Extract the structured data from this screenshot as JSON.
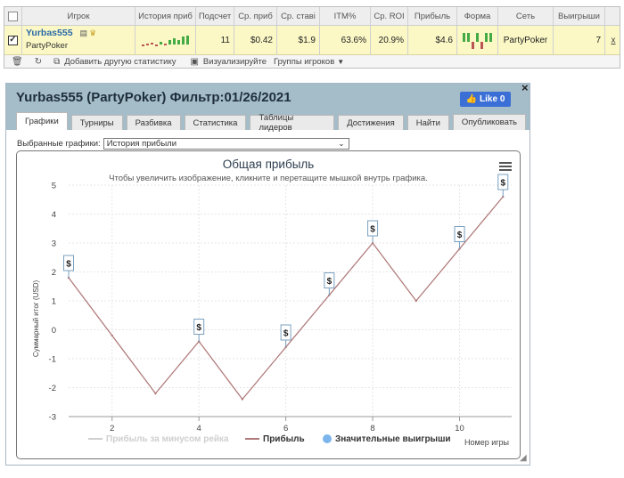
{
  "stats_table": {
    "headers": {
      "player": "Игрок",
      "profit_history": "История приб",
      "count": "Подсчет",
      "avg_profit": "Ср. приб",
      "avg_stake": "Ср. ставі",
      "itm": "ITM%",
      "avg_roi": "Ср. ROI",
      "profit": "Прибыль",
      "form": "Форма",
      "network": "Сеть",
      "wins": "Выигрыши"
    },
    "row": {
      "player_name": "Yurbas555",
      "player_network": "PartyPoker",
      "count": "11",
      "avg_profit": "$0.42",
      "avg_stake": "$1.9",
      "itm": "63.6%",
      "avg_roi": "20.9%",
      "profit": "$4.6",
      "network": "PartyPoker",
      "wins": "7",
      "remove": "x"
    },
    "toolbar": {
      "add_stats": "Добавить другую статистику",
      "visualize": "Визуализируйте",
      "player_groups": "Группы игроков"
    }
  },
  "dialog": {
    "title": "Yurbas555 (PartyPoker) Фильтр:01/26/2021",
    "like_label": "Like 0",
    "close": "×",
    "tabs": [
      "Графики",
      "Турниры",
      "Разбивка",
      "Статистика",
      "Таблицы лидеров",
      "Достижения",
      "Найти"
    ],
    "publish": "Опубликовать",
    "selected_charts_label": "Выбранные графики:",
    "selected_chart_value": "История прибыли"
  },
  "colors": {
    "accent": "#2a6aa8",
    "profit_line": "#b07a7a",
    "rake_line": "#cfcfcf",
    "big_wins_marker": "#7cb5ec",
    "like_button": "#3b6fd6",
    "titlebar": "#a5bcc9"
  },
  "chart_data": {
    "type": "line",
    "title": "Общая прибыль",
    "subtitle": "Чтобы увеличить изображение, кликните и перетащите мышкой внутрь графика.",
    "xlabel": "Номер игры",
    "ylabel": "Суммарный итог (USD)",
    "xlim": [
      1,
      11.2
    ],
    "ylim": [
      -3,
      5
    ],
    "x_ticks": [
      2,
      4,
      6,
      8,
      10
    ],
    "y_ticks": [
      -3,
      -2,
      -1,
      0,
      1,
      2,
      3,
      4,
      5
    ],
    "grid": true,
    "legend_position": "bottom",
    "series": [
      {
        "name": "Прибыль за минусом рейка",
        "visible": false,
        "x": [],
        "values": []
      },
      {
        "name": "Прибыль",
        "x": [
          1,
          2,
          3,
          4,
          5,
          6,
          7,
          8,
          9,
          10,
          11
        ],
        "values": [
          1.8,
          -0.2,
          -2.2,
          -0.4,
          -2.4,
          -0.6,
          1.2,
          3.0,
          1.0,
          2.8,
          4.6
        ]
      }
    ],
    "big_wins": {
      "name": "Значительные выигрыши",
      "label": "$",
      "x": [
        1,
        4,
        6,
        7,
        8,
        10,
        11
      ],
      "values": [
        1.8,
        -0.4,
        -0.6,
        1.2,
        3.0,
        2.8,
        4.6
      ]
    }
  }
}
